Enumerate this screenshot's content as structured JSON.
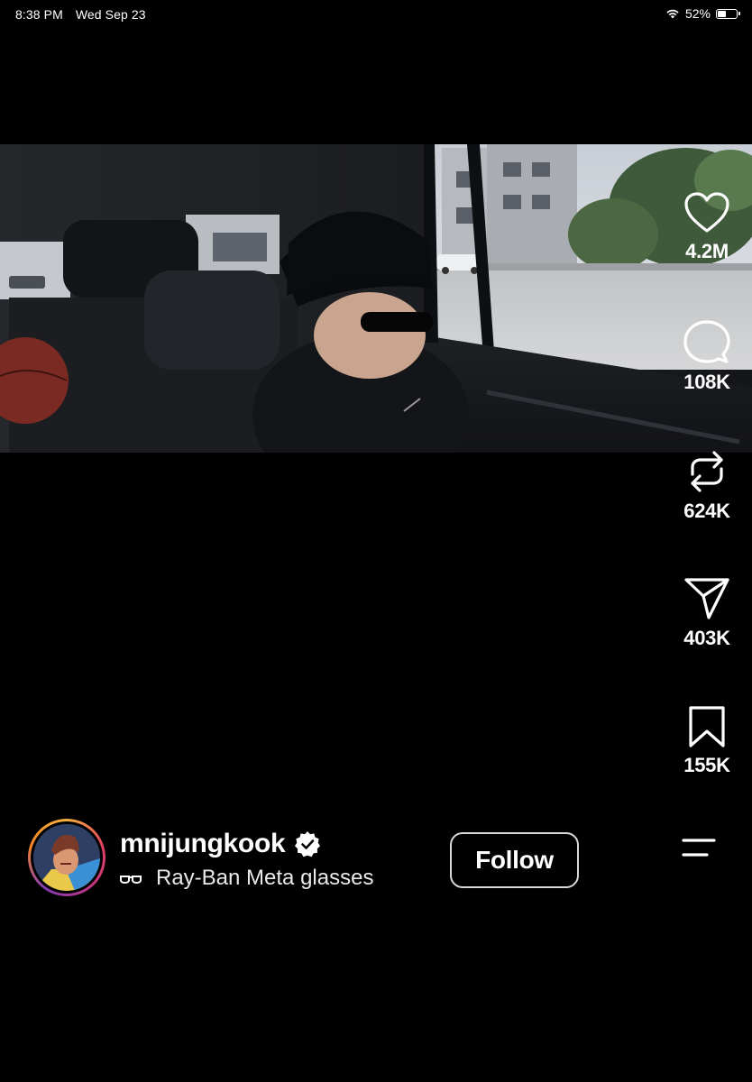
{
  "status_bar": {
    "time": "8:38 PM",
    "date": "Wed Sep 23",
    "battery_percent": "52%",
    "battery_level": 0.52
  },
  "actions": {
    "likes": "4.2M",
    "comments": "108K",
    "reposts": "624K",
    "shares": "403K",
    "saves": "155K"
  },
  "post": {
    "username": "mnijungkook",
    "verified": true,
    "caption": "Ray-Ban Meta glasses"
  },
  "follow_label": "Follow",
  "icons": {
    "like": "heart-icon",
    "comment": "comment-bubble-icon",
    "repost": "repost-icon",
    "share": "send-icon",
    "save": "bookmark-icon",
    "menu": "menu-icon",
    "caption": "glasses-icon",
    "verified": "verified-badge-icon"
  }
}
